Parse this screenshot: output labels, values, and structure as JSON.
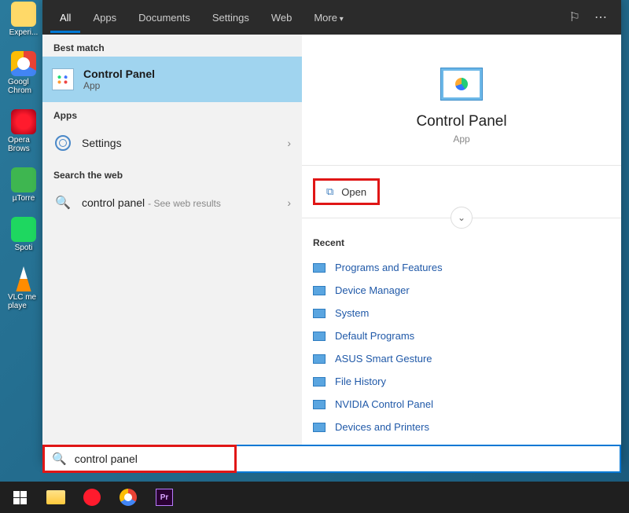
{
  "desktop": {
    "icons": [
      {
        "label": "Experi..."
      },
      {
        "label": "Googl\nChrom"
      },
      {
        "label": "Opera\nBrows"
      },
      {
        "label": "µTorre"
      },
      {
        "label": "Spoti"
      },
      {
        "label": "VLC me\nplaye"
      }
    ]
  },
  "tabs": {
    "items": [
      "All",
      "Apps",
      "Documents",
      "Settings",
      "Web",
      "More"
    ],
    "active": 0
  },
  "left": {
    "best_match_label": "Best match",
    "best_match": {
      "title": "Control Panel",
      "sub": "App"
    },
    "apps_label": "Apps",
    "settings_item": "Settings",
    "search_web_label": "Search the web",
    "web_item": {
      "text": "control panel",
      "sub": "- See web results"
    }
  },
  "right": {
    "title": "Control Panel",
    "sub": "App",
    "open_label": "Open",
    "recent_label": "Recent",
    "recent_items": [
      "Programs and Features",
      "Device Manager",
      "System",
      "Default Programs",
      "ASUS Smart Gesture",
      "File History",
      "NVIDIA Control Panel",
      "Devices and Printers"
    ]
  },
  "search": {
    "value": "control panel"
  },
  "taskbar": {
    "pr_label": "Pr"
  }
}
